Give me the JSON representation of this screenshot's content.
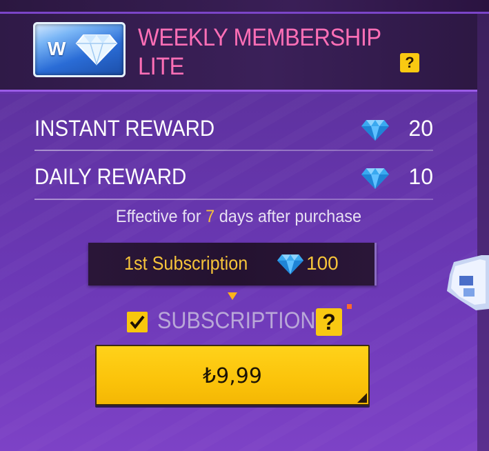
{
  "header": {
    "badge_letter": "W",
    "title_line1": "WEEKLY MEMBERSHIP",
    "title_line2": "LITE",
    "help_label": "?"
  },
  "rewards": [
    {
      "label": "INSTANT REWARD",
      "icon": "diamond-icon",
      "amount": "20"
    },
    {
      "label": "DAILY REWARD",
      "icon": "diamond-icon",
      "amount": "10"
    }
  ],
  "effective": {
    "prefix": "Effective for ",
    "days": "7",
    "suffix": " days after purchase"
  },
  "first_subscription": {
    "label": "1st Subscription",
    "icon": "diamond-icon",
    "price": "100"
  },
  "subscription": {
    "checked": true,
    "label": "SUBSCRIPTION",
    "help_label": "?"
  },
  "buy_button": {
    "price": "₺9,99"
  },
  "colors": {
    "accent_yellow": "#f9c912",
    "title_pink": "#ff6fb6",
    "panel_purple": "#6b38b5",
    "gold_text": "#f6c43a"
  }
}
